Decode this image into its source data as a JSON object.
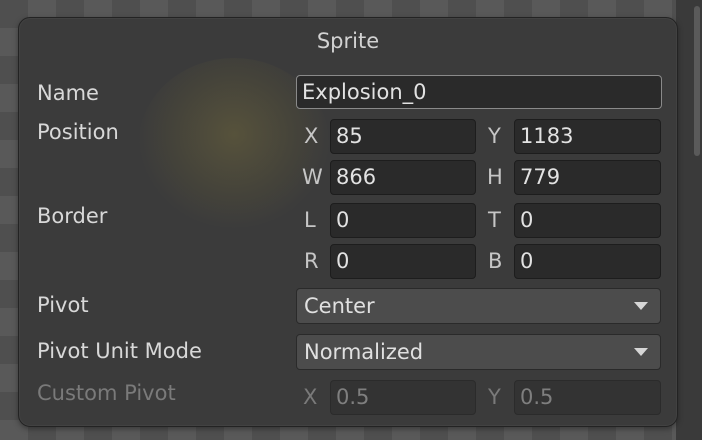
{
  "panel": {
    "title": "Sprite"
  },
  "name": {
    "label": "Name",
    "value": "Explosion_0"
  },
  "position": {
    "label": "Position",
    "x_label": "X",
    "x_value": "85",
    "y_label": "Y",
    "y_value": "1183",
    "w_label": "W",
    "w_value": "866",
    "h_label": "H",
    "h_value": "779"
  },
  "border": {
    "label": "Border",
    "l_label": "L",
    "l_value": "0",
    "t_label": "T",
    "t_value": "0",
    "r_label": "R",
    "r_value": "0",
    "b_label": "B",
    "b_value": "0"
  },
  "pivot": {
    "label": "Pivot",
    "selected": "Center",
    "arrow_icon": "dropdown-triangle"
  },
  "pivot_unit_mode": {
    "label": "Pivot Unit Mode",
    "selected": "Normalized",
    "arrow_icon": "dropdown-triangle"
  },
  "custom_pivot": {
    "label": "Custom Pivot",
    "x_label": "X",
    "x_value": "0.5",
    "y_label": "Y",
    "y_value": "0.5",
    "enabled": false
  },
  "colors": {
    "panel_bg": "#3a3a3a",
    "field_bg": "#2a2a2a",
    "dropdown_bg": "#4c4c4c",
    "text": "#d8d8d8",
    "disabled_text": "#7a7a7a"
  }
}
